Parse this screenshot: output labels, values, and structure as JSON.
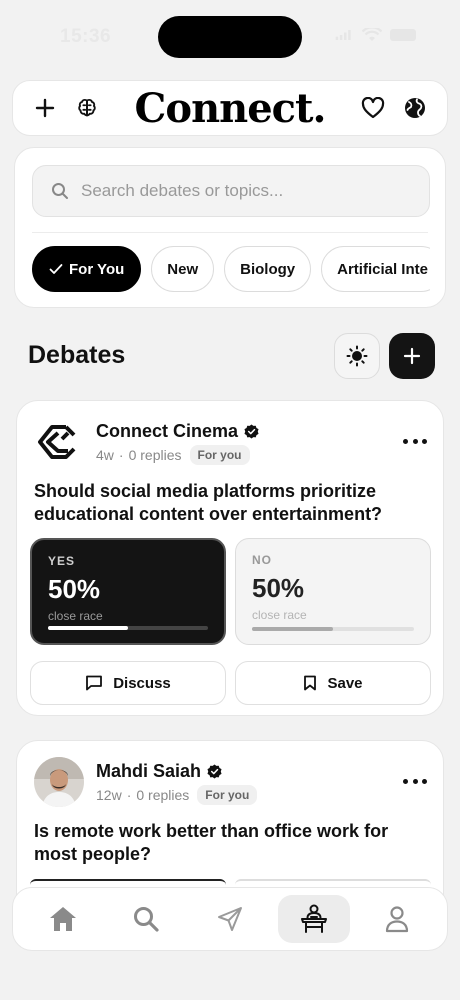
{
  "status_bar": {
    "time": "15:36"
  },
  "header": {
    "brand": "Connect.",
    "icons": [
      "plus-icon",
      "brain-icon",
      "heart-icon",
      "globe-icon"
    ]
  },
  "search": {
    "placeholder": "Search debates or topics..."
  },
  "chips": [
    {
      "label": "For You",
      "active": true
    },
    {
      "label": "New",
      "active": false
    },
    {
      "label": "Biology",
      "active": false
    },
    {
      "label": "Artificial Inte",
      "active": false
    }
  ],
  "section": {
    "title": "Debates"
  },
  "debates": [
    {
      "author": "Connect Cinema",
      "age": "4w",
      "replies": "0 replies",
      "tag": "For you",
      "question": "Should social media platforms prioritize educational content over entertainment?",
      "yes": {
        "label": "YES",
        "percent": "50%",
        "note": "close race",
        "value": 0.5
      },
      "no": {
        "label": "NO",
        "percent": "50%",
        "note": "close race",
        "value": 0.5
      },
      "discuss_label": "Discuss",
      "save_label": "Save"
    },
    {
      "author": "Mahdi Saiah",
      "age": "12w",
      "replies": "0 replies",
      "tag": "For you",
      "question": "Is remote work better than office work for most people?"
    }
  ],
  "meta_separator": "·",
  "bottom_nav": [
    {
      "icon": "home-icon",
      "active": false
    },
    {
      "icon": "search-icon",
      "active": false
    },
    {
      "icon": "send-icon",
      "active": false
    },
    {
      "icon": "debate-podium-icon",
      "active": true
    },
    {
      "icon": "profile-icon",
      "active": false
    }
  ]
}
